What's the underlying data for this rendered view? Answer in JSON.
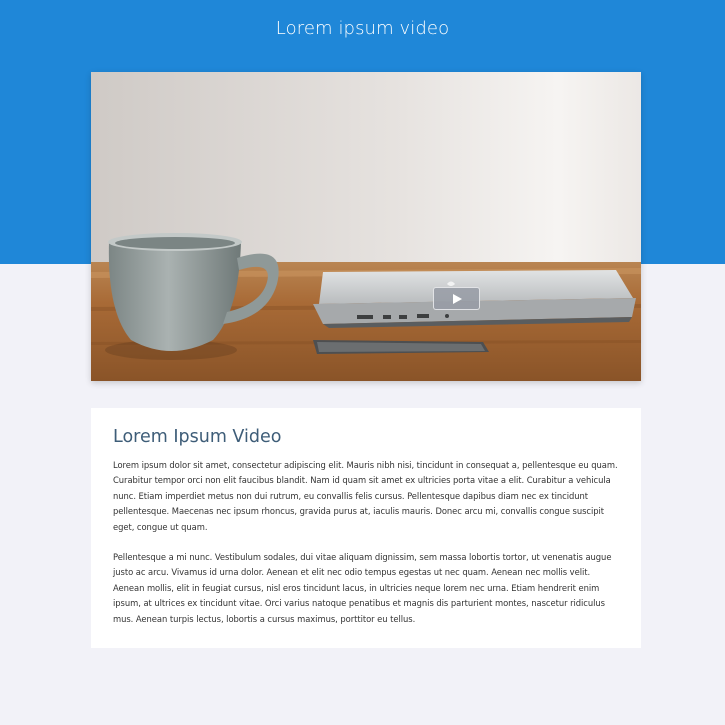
{
  "header": {
    "title": "Lorem ipsum video",
    "background": "#1f87d8"
  },
  "video": {
    "play_icon": "play-icon",
    "thumbnail_description_colors": {
      "table": "#a86d3a",
      "cup": "#8e9898",
      "laptop": "#c9cbcc"
    }
  },
  "article": {
    "title": "Lorem Ipsum Video",
    "paragraphs": [
      "Lorem ipsum dolor sit amet, consectetur adipiscing elit. Mauris nibh nisi, tincidunt in consequat a, pellentesque eu quam. Curabitur tempor orci non elit faucibus blandit. Nam id quam sit amet ex ultricies porta vitae a elit. Curabitur a vehicula nunc. Etiam imperdiet metus non dui rutrum, eu convallis felis cursus. Pellentesque dapibus diam nec ex tincidunt pellentesque. Maecenas nec ipsum rhoncus, gravida purus at, iaculis mauris. Donec arcu mi, convallis congue suscipit eget, congue ut quam.",
      "Pellentesque a mi nunc. Vestibulum sodales, dui vitae aliquam dignissim, sem massa lobortis tortor, ut venenatis augue justo ac arcu. Vivamus id urna dolor. Aenean et elit nec odio tempus egestas ut nec quam. Aenean nec mollis velit. Aenean mollis, elit in feugiat cursus, nisl eros tincidunt lacus, in ultricies neque lorem nec urna. Etiam hendrerit enim ipsum, at ultrices ex tincidunt vitae. Orci varius natoque penatibus et magnis dis parturient montes, nascetur ridiculus mus. Aenean turpis lectus, lobortis a cursus maximus, porttitor eu tellus."
    ]
  }
}
